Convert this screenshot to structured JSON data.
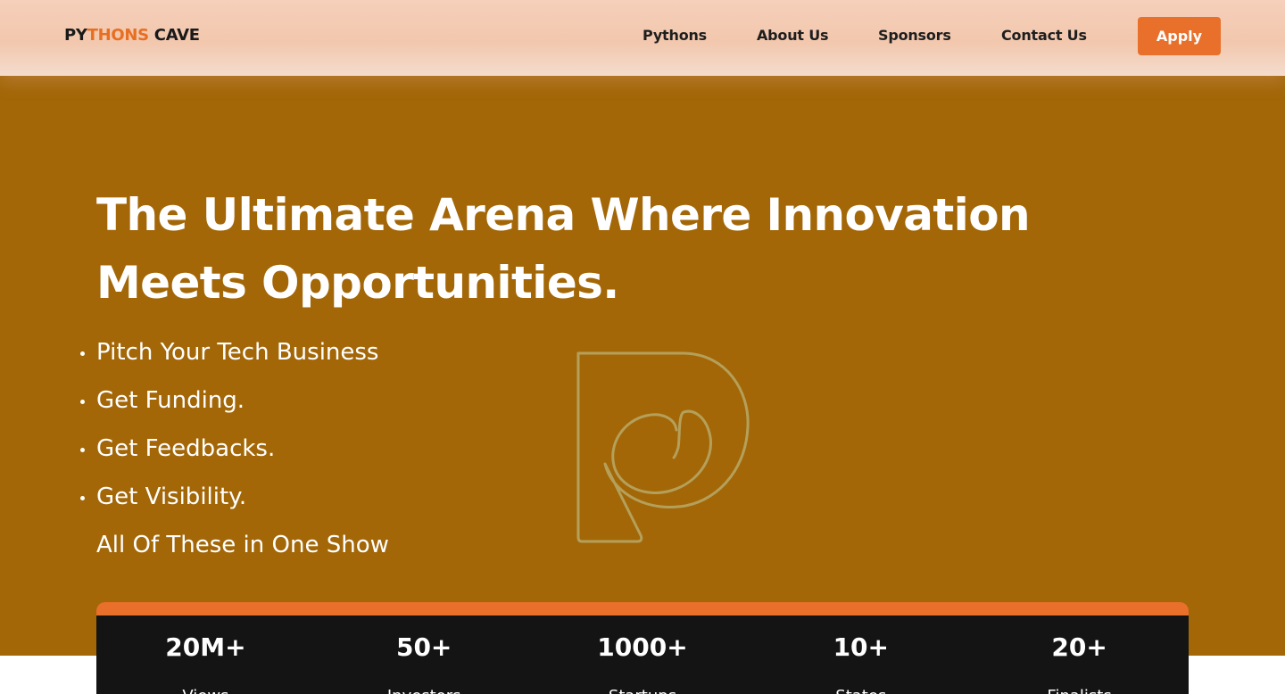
{
  "header": {
    "brand": {
      "part1": "PY",
      "part2": "THONS",
      "part3": " CAVE"
    },
    "nav": [
      "Pythons",
      "About Us",
      "Sponsors",
      "Contact Us"
    ],
    "apply_label": "Apply"
  },
  "hero": {
    "headline": "The Ultimate Arena Where Innovation Meets Opportunities.",
    "bullets": [
      "Pitch Your Tech Business",
      "Get Funding.",
      "Get Feedbacks.",
      "Get Visibility."
    ],
    "tagline": "All Of These in One Show",
    "logo_icon": "p-logo-icon"
  },
  "stats": [
    {
      "value": "20M+",
      "label": "Views"
    },
    {
      "value": "50+",
      "label": "Investors"
    },
    {
      "value": "1000+",
      "label": "Startups"
    },
    {
      "value": "10+",
      "label": "States"
    },
    {
      "value": "20+",
      "label": "Finalists"
    }
  ],
  "colors": {
    "accent": "#e8702a",
    "hero_bg": "#a36708",
    "stats_bg": "#141414"
  }
}
